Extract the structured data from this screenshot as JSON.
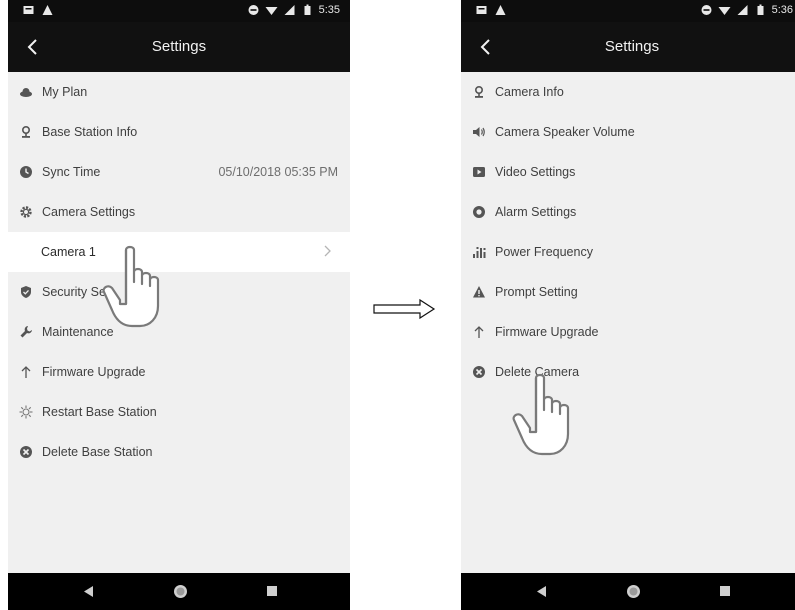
{
  "left_screen": {
    "status": {
      "time": "5:35"
    },
    "title": "Settings",
    "items": [
      {
        "label": "My Plan",
        "icon": "cloud-icon",
        "value": ""
      },
      {
        "label": "Base Station Info",
        "icon": "base-station-icon",
        "value": ""
      },
      {
        "label": "Sync Time",
        "icon": "clock-icon",
        "value": "05/10/2018 05:35 PM"
      },
      {
        "label": "Camera Settings",
        "icon": "gear-icon",
        "value": ""
      }
    ],
    "sub_item": {
      "label": "Camera 1"
    },
    "items_after": [
      {
        "label": "Security Se",
        "icon": "shield-icon"
      },
      {
        "label": "Maintenance",
        "icon": "wrench-icon"
      },
      {
        "label": "Firmware Upgrade",
        "icon": "arrow-up-icon"
      },
      {
        "label": "Restart Base Station",
        "icon": "restart-icon"
      },
      {
        "label": "Delete Base Station",
        "icon": "delete-icon"
      }
    ]
  },
  "right_screen": {
    "status": {
      "time": "5:36"
    },
    "title": "Settings",
    "items": [
      {
        "label": "Camera Info",
        "icon": "camera-info-icon"
      },
      {
        "label": "Camera Speaker Volume",
        "icon": "speaker-icon"
      },
      {
        "label": "Video Settings",
        "icon": "video-icon"
      },
      {
        "label": "Alarm Settings",
        "icon": "alarm-icon"
      },
      {
        "label": "Power Frequency",
        "icon": "power-frequency-icon"
      },
      {
        "label": "Prompt Setting",
        "icon": "prompt-icon"
      },
      {
        "label": "Firmware Upgrade",
        "icon": "arrow-up-icon"
      },
      {
        "label": "Delete Camera",
        "icon": "delete-icon"
      }
    ]
  },
  "colors": {
    "status_bar": "#0d0d0d",
    "title_bar": "#111111",
    "list_background": "#f0f0f0",
    "highlight_row": "#ffffff",
    "text": "#3f3f3f",
    "icon": "#555555"
  }
}
